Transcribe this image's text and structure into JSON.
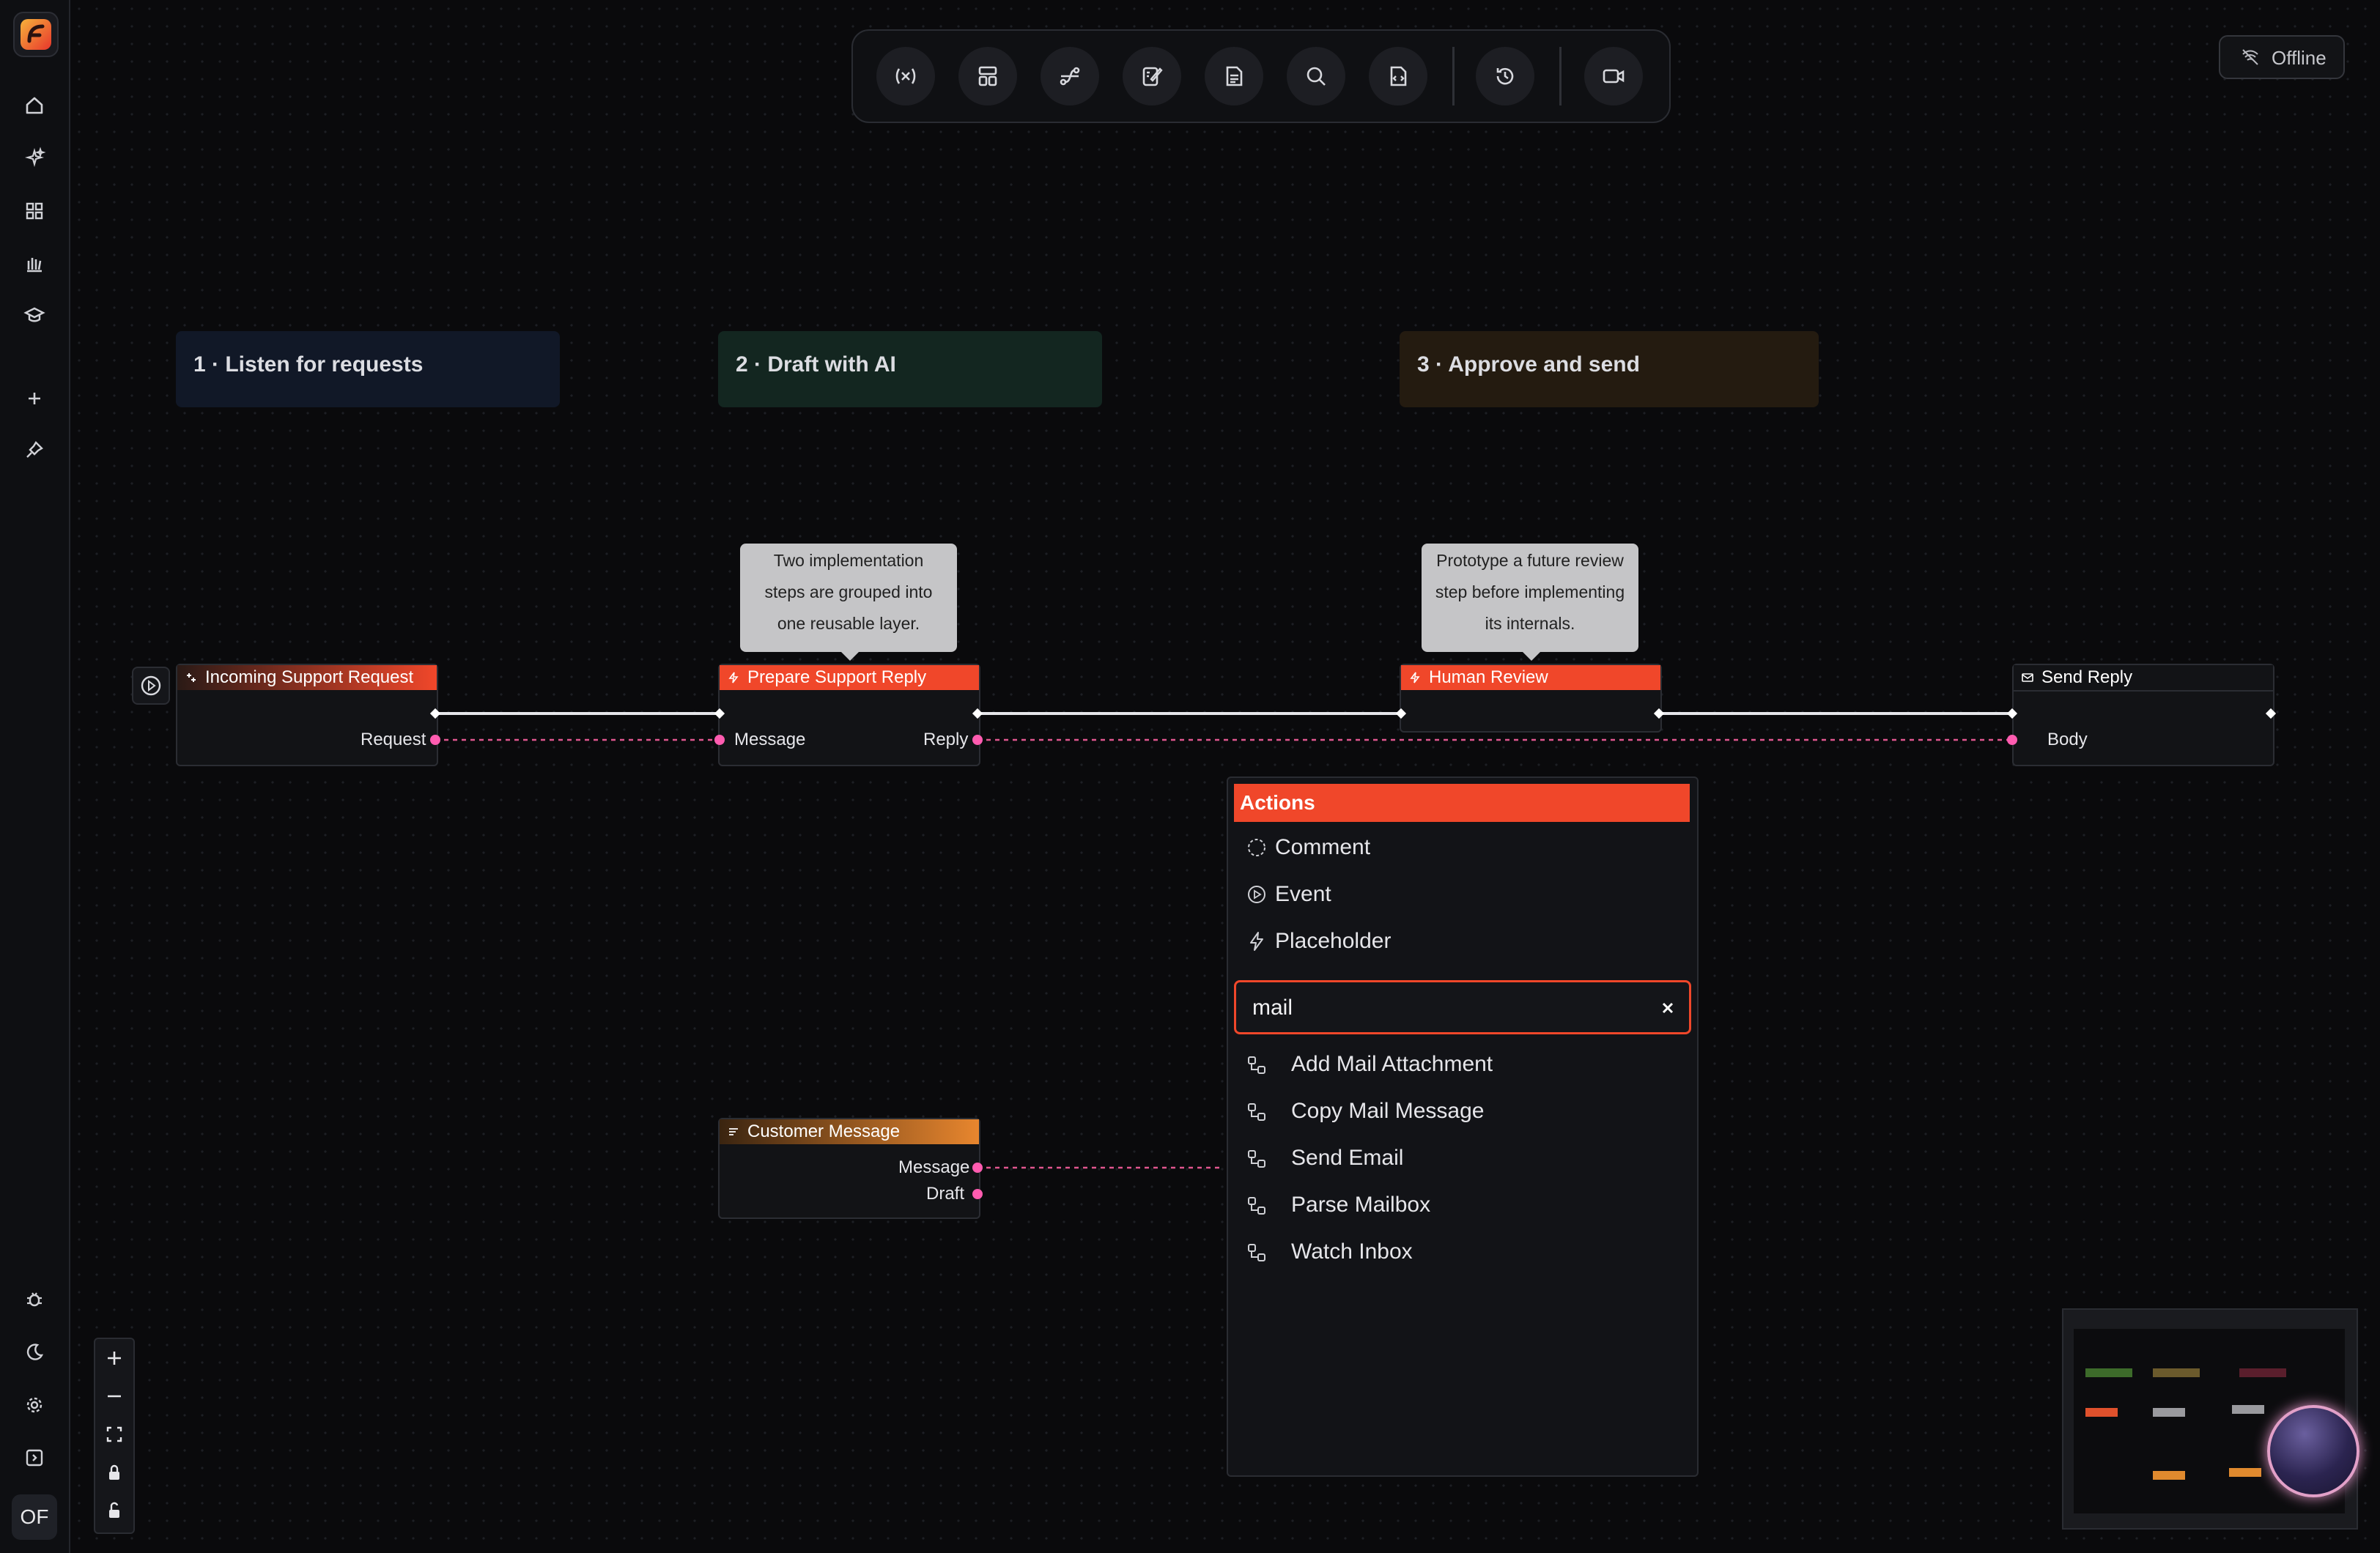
{
  "sidebar": {
    "avatar": "OF",
    "icons": [
      "home-icon",
      "sparkles-icon",
      "grid-icon",
      "library-icon",
      "graduation-cap-icon",
      "plus-icon",
      "pin-icon",
      "bug-icon",
      "moon-icon",
      "settings-icon",
      "expand-panel-icon"
    ]
  },
  "toolbar": {
    "buttons": [
      "variables-icon",
      "layout-icon",
      "route-icon",
      "notebook-edit-icon",
      "document-icon",
      "search-icon",
      "code-file-icon",
      "history-icon",
      "video-icon"
    ]
  },
  "status": {
    "label": "Offline"
  },
  "groups": [
    {
      "label": "1 · Listen for requests",
      "color": "#111827"
    },
    {
      "label": "2 · Draft with AI",
      "color": "#132620"
    },
    {
      "label": "3 · Approve and send",
      "color": "#241b10"
    }
  ],
  "tooltips": {
    "prepare": [
      "Two implementation",
      "steps are grouped into",
      "one reusable layer."
    ],
    "review": [
      "Prototype a future review",
      "step before implementing",
      "its internals."
    ]
  },
  "nodes": {
    "incoming": {
      "title": "Incoming Support Request",
      "output": "Request"
    },
    "prepare": {
      "title": "Prepare Support Reply",
      "input": "Message",
      "output": "Reply"
    },
    "review": {
      "title": "Human Review"
    },
    "send": {
      "title": "Send Reply",
      "input": "Body"
    },
    "customer": {
      "title": "Customer Message",
      "outputs": [
        "Message",
        "Draft"
      ]
    }
  },
  "menu": {
    "title": "Actions",
    "items": [
      {
        "label": "Comment",
        "icon": "comment-dashed-circle-icon"
      },
      {
        "label": "Event",
        "icon": "play-circle-icon"
      },
      {
        "label": "Placeholder",
        "icon": "lightning-icon"
      }
    ],
    "search": {
      "value": "mail"
    },
    "results": [
      {
        "label": "Add Mail Attachment",
        "icon": "node-link-icon"
      },
      {
        "label": "Copy Mail Message",
        "icon": "node-link-icon"
      },
      {
        "label": "Send Email",
        "icon": "node-link-icon"
      },
      {
        "label": "Parse Mailbox",
        "icon": "node-link-icon"
      },
      {
        "label": "Watch Inbox",
        "icon": "node-link-icon"
      }
    ]
  },
  "colors": {
    "accent": "#f0472a",
    "port": "#ff5cb0",
    "customer_header": "#e8862e"
  }
}
